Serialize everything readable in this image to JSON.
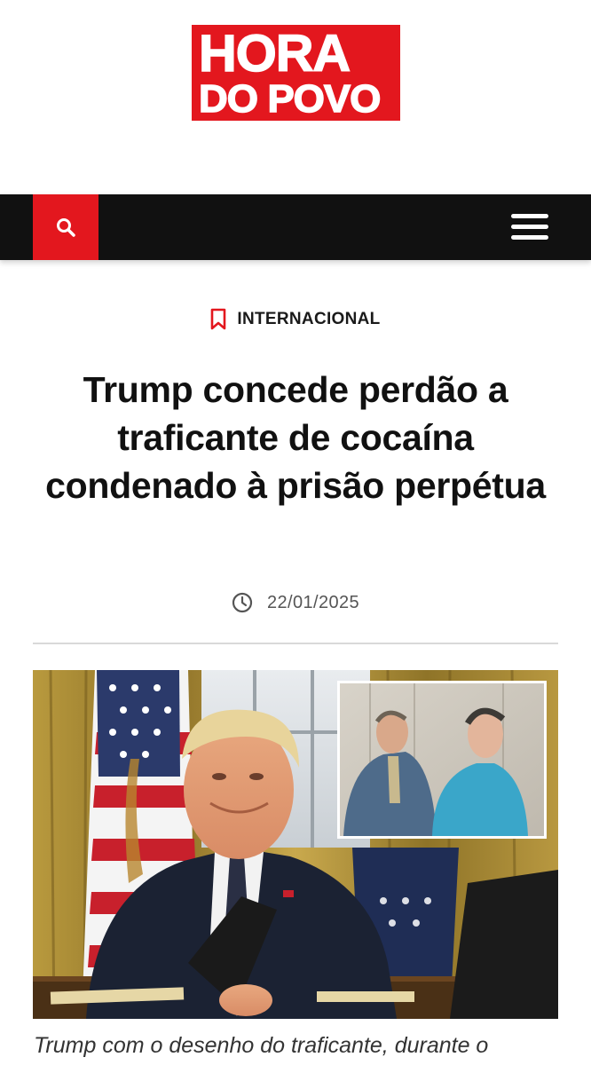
{
  "logo": {
    "line1": "HORA",
    "line2": "DO POVO",
    "color": "#e3171e"
  },
  "navbar": {
    "search_icon": "search-icon",
    "menu_icon": "hamburger-menu-icon",
    "background": "#111111",
    "accent": "#e3171e"
  },
  "article": {
    "category": "INTERNACIONAL",
    "category_icon": "bookmark-icon",
    "title": "Trump concede perdão a traficante de cocaína condenado à prisão perpétua",
    "date_icon": "clock-icon",
    "date": "22/01/2025",
    "image_alt": "Trump com o desenho do traficante",
    "caption": "Trump com o desenho do traficante, durante o"
  }
}
